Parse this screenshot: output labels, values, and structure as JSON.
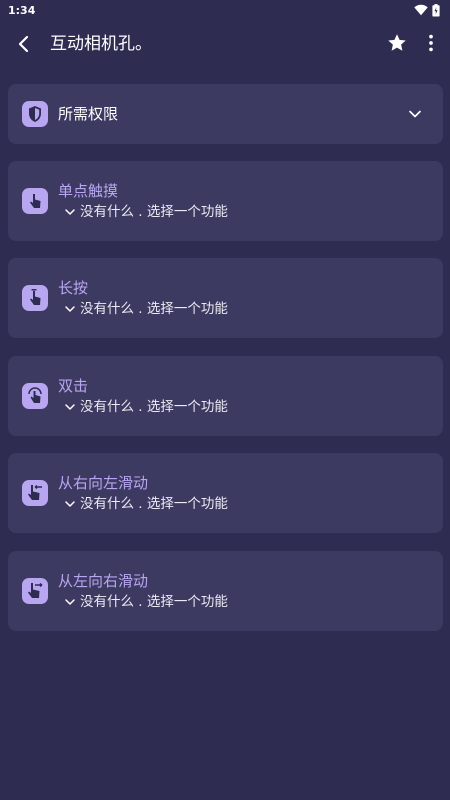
{
  "status": {
    "time": "1:34"
  },
  "appbar": {
    "title": "互动相机孔。"
  },
  "permissions": {
    "label": "所需权限"
  },
  "gestures": [
    {
      "label": "单点触摸",
      "action": "没有什么 . 选择一个功能"
    },
    {
      "label": "长按",
      "action": "没有什么 . 选择一个功能"
    },
    {
      "label": "双击",
      "action": "没有什么 . 选择一个功能"
    },
    {
      "label": "从右向左滑动",
      "action": "没有什么 . 选择一个功能"
    },
    {
      "label": "从左向右滑动",
      "action": "没有什么 . 选择一个功能"
    }
  ],
  "colors": {
    "background": "#2f2c51",
    "card": "#3d3a61",
    "accent": "#b9a6f0",
    "icon_bg": "#b9a6f0"
  }
}
